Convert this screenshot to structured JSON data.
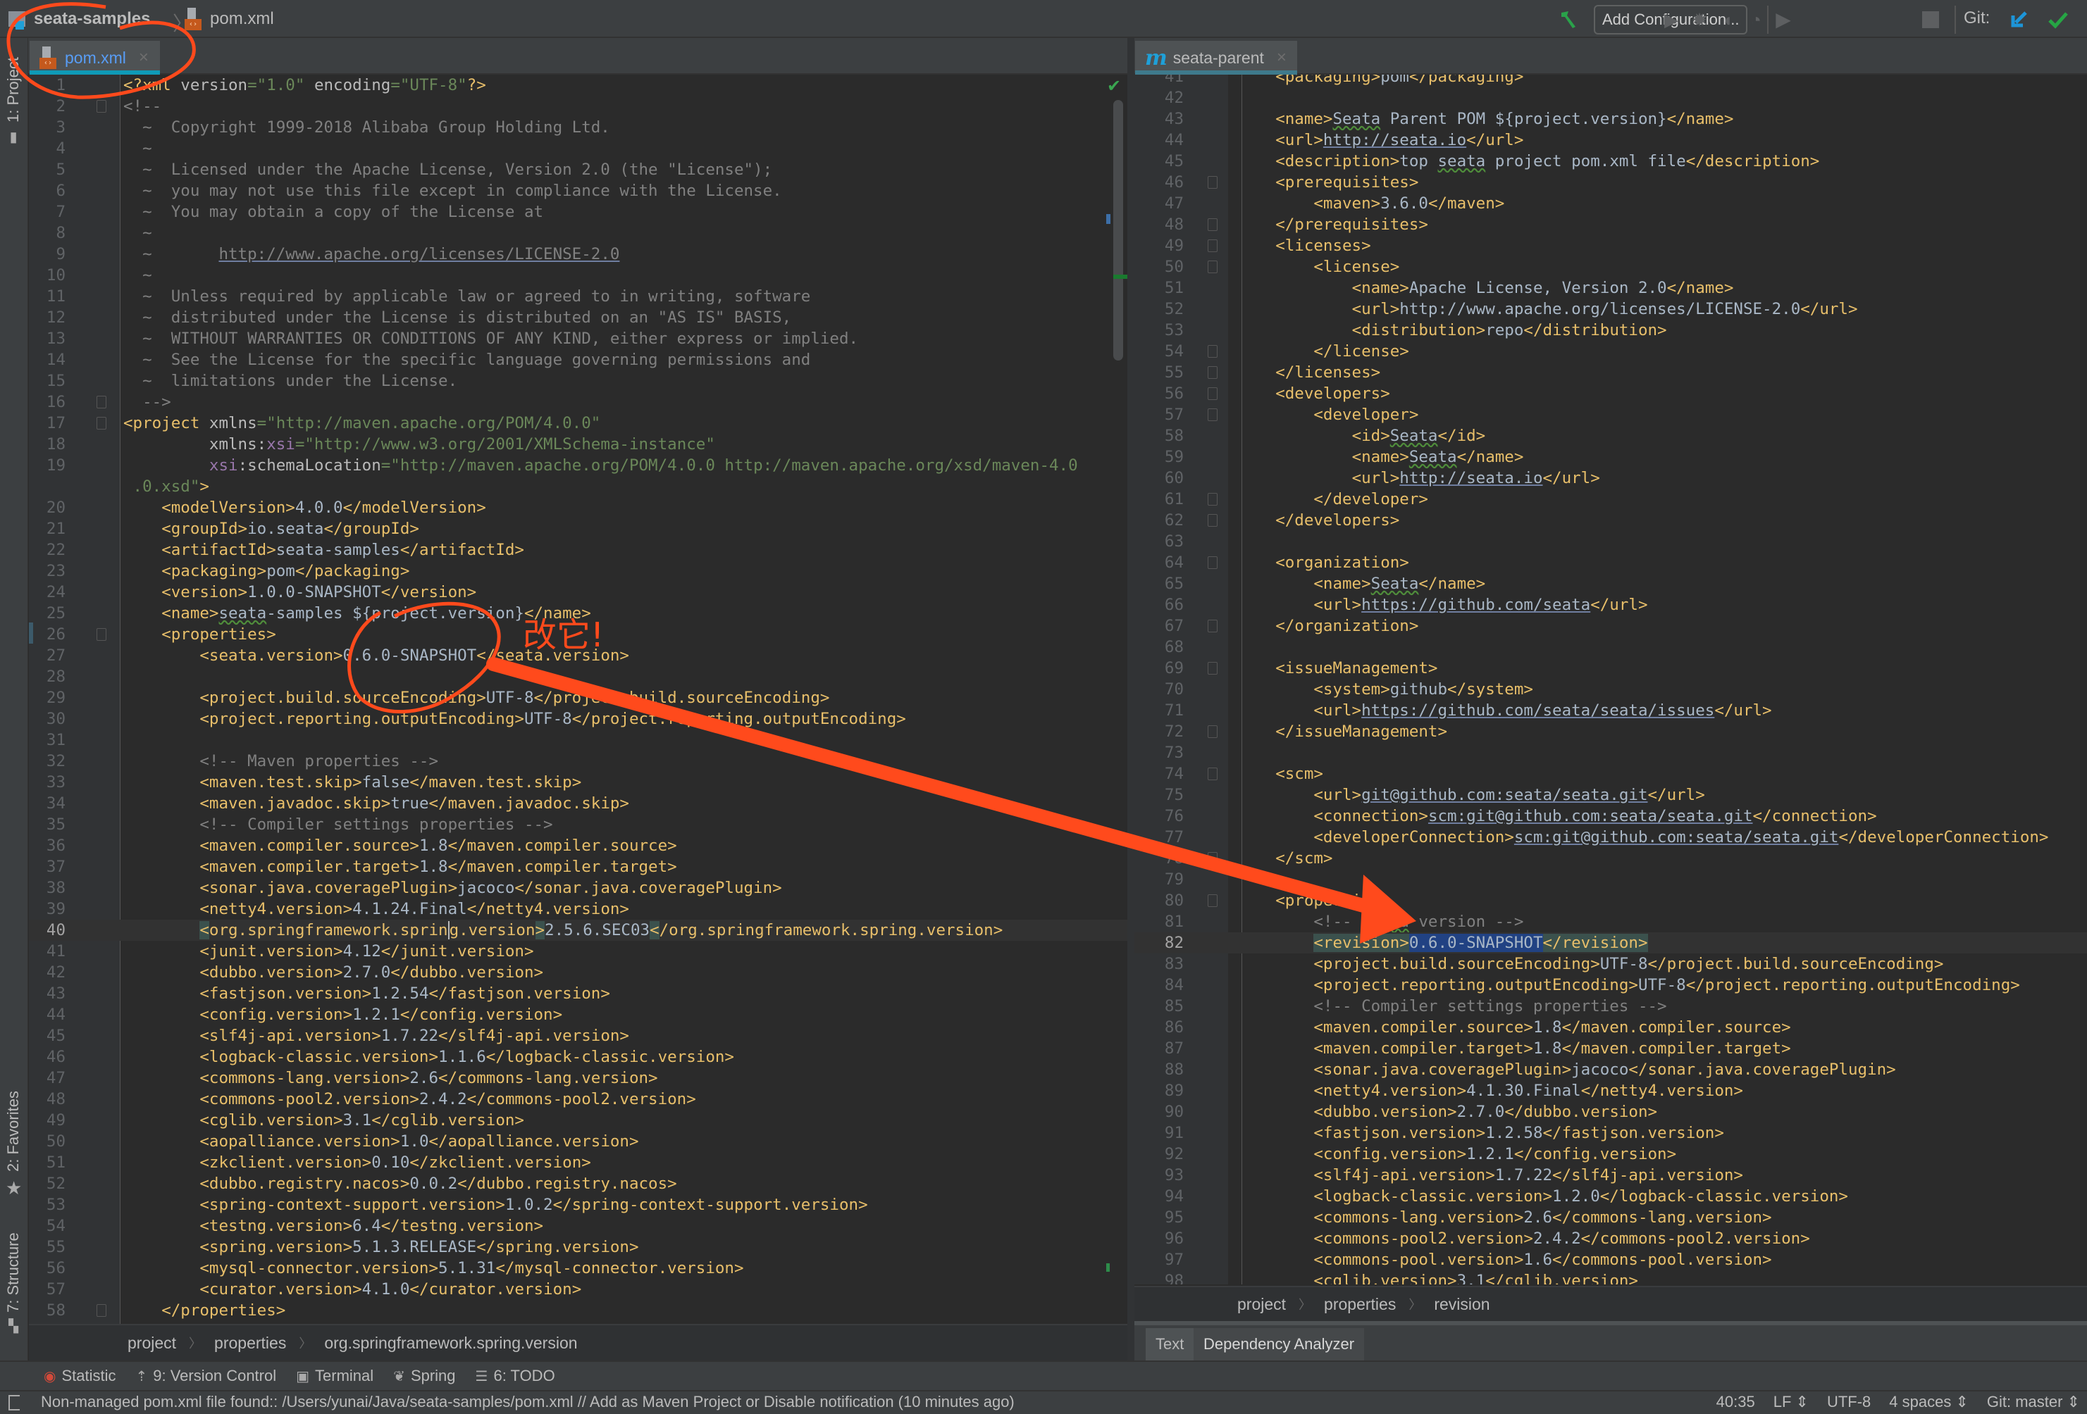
{
  "navbar": {
    "project": "seata-samples",
    "file": "pom.xml",
    "add_configuration": "Add Configuration...",
    "git_label": "Git:",
    "icons": [
      "build-hammer-icon",
      "run-icon",
      "debug-icon",
      "coverage-icon",
      "profile-icon",
      "stop-icon",
      "git-update-icon",
      "git-commit-icon"
    ]
  },
  "tabs": {
    "left": {
      "label": "pom.xml",
      "icon": "xml-file-icon"
    },
    "right": {
      "label": "seata-parent",
      "icon": "maven-icon"
    }
  },
  "left_strip": {
    "project": "1: Project",
    "favorites": "2: Favorites",
    "structure": "7: Structure"
  },
  "left_editor": {
    "current_line": 40,
    "lines": [
      {
        "n": "1",
        "h": "<span class='t'>&lt;?</span><span class='t'>xml</span> <span class='a'>version</span><span class='s'>=\"1.0\"</span> <span class='a'>encoding</span><span class='s'>=\"UTF-8\"</span><span class='t'>?&gt;</span>"
      },
      {
        "n": "2",
        "h": "<span class='c'>&lt;!--</span>",
        "fold": true
      },
      {
        "n": "3",
        "h": "<span class='c'>  ~  Copyright 1999-2018 Alibaba Group Holding Ltd.</span>"
      },
      {
        "n": "4",
        "h": "<span class='c'>  ~</span>"
      },
      {
        "n": "5",
        "h": "<span class='c'>  ~  Licensed under the Apache License, Version 2.0 (the \"License\");</span>"
      },
      {
        "n": "6",
        "h": "<span class='c'>  ~  you may not use this file except in compliance with the License.</span>"
      },
      {
        "n": "7",
        "h": "<span class='c'>  ~  You may obtain a copy of the License at</span>"
      },
      {
        "n": "8",
        "h": "<span class='c'>  ~</span>"
      },
      {
        "n": "9",
        "h": "<span class='c'>  ~       <span class='u' style='color:#808080'>http://www.apache.org/licenses/LICENSE-2.0</span></span>"
      },
      {
        "n": "10",
        "h": "<span class='c'>  ~</span>"
      },
      {
        "n": "11",
        "h": "<span class='c'>  ~  Unless required by applicable law or agreed to in writing, software</span>"
      },
      {
        "n": "12",
        "h": "<span class='c'>  ~  distributed under the License is distributed on an \"AS IS\" BASIS,</span>"
      },
      {
        "n": "13",
        "h": "<span class='c'>  ~  WITHOUT WARRANTIES OR CONDITIONS OF ANY KIND, either express or implied.</span>"
      },
      {
        "n": "14",
        "h": "<span class='c'>  ~  See the License for the specific language governing permissions and</span>"
      },
      {
        "n": "15",
        "h": "<span class='c'>  ~  limitations under the License.</span>"
      },
      {
        "n": "16",
        "h": "<span class='c'>  --&gt;</span>",
        "fold": true
      },
      {
        "n": "17",
        "h": "<span class='t'>&lt;project</span> <span class='a'>xmlns</span><span class='s'>=\"http://maven.apache.org/POM/4.0.0\"</span>",
        "fold": true
      },
      {
        "n": "18",
        "h": "         <span class='a'>xmlns:</span><span class='ns'>xsi</span><span class='s'>=\"http://www.w3.org/2001/XMLSchema-instance\"</span>"
      },
      {
        "n": "19",
        "h": "         <span class='ns'>xsi</span><span class='a'>:schemaLocation</span><span class='s'>=\"http://maven.apache.org/POM/4.0.0 http://maven.apache.org/xsd/maven-4.0</span>"
      },
      {
        "n": "",
        "h": " <span class='s'>.0.xsd\"</span><span class='t'>&gt;</span>"
      },
      {
        "n": "20",
        "h": "    <span class='t'>&lt;modelVersion&gt;</span>4.0.0<span class='t'>&lt;/modelVersion&gt;</span>"
      },
      {
        "n": "21",
        "h": "    <span class='t'>&lt;groupId&gt;</span>io.seata<span class='t'>&lt;/groupId&gt;</span>"
      },
      {
        "n": "22",
        "h": "    <span class='t'>&lt;artifactId&gt;</span>seata-samples<span class='t'>&lt;/artifactId&gt;</span>"
      },
      {
        "n": "23",
        "h": "    <span class='t'>&lt;packaging&gt;</span>pom<span class='t'>&lt;/packaging&gt;</span>"
      },
      {
        "n": "24",
        "h": "    <span class='t'>&lt;version&gt;</span>1.0.0-SNAPSHOT<span class='t'>&lt;/version&gt;</span>"
      },
      {
        "n": "25",
        "h": "    <span class='t'>&lt;name&gt;</span><span class='sq'>seata</span>-samples ${project.version}<span class='t'>&lt;/name&gt;</span>"
      },
      {
        "n": "26",
        "h": "    <span class='t'>&lt;properties&gt;</span>",
        "fold": true
      },
      {
        "n": "27",
        "h": "        <span class='t'>&lt;seata.version&gt;</span>0.6.0-SNAPSHOT<span class='t'>&lt;/seata.version&gt;</span>"
      },
      {
        "n": "28",
        "h": ""
      },
      {
        "n": "29",
        "h": "        <span class='t'>&lt;project.build.sourceEncoding&gt;</span>UTF-8<span class='t'>&lt;/project.build.sourceEncoding&gt;</span>"
      },
      {
        "n": "30",
        "h": "        <span class='t'>&lt;project.reporting.outputEncoding&gt;</span>UTF-8<span class='t'>&lt;/project.reporting.outputEncoding&gt;</span>"
      },
      {
        "n": "31",
        "h": ""
      },
      {
        "n": "32",
        "h": "        <span class='c'>&lt;!-- Maven properties --&gt;</span>"
      },
      {
        "n": "33",
        "h": "        <span class='t'>&lt;maven.test.skip&gt;</span>false<span class='t'>&lt;/maven.test.skip&gt;</span>"
      },
      {
        "n": "34",
        "h": "        <span class='t'>&lt;maven.javadoc.skip&gt;</span>true<span class='t'>&lt;/maven.javadoc.skip&gt;</span>"
      },
      {
        "n": "35",
        "h": "        <span class='c'>&lt;!-- Compiler settings properties --&gt;</span>"
      },
      {
        "n": "36",
        "h": "        <span class='t'>&lt;maven.compiler.source&gt;</span>1.8<span class='t'>&lt;/maven.compiler.source&gt;</span>"
      },
      {
        "n": "37",
        "h": "        <span class='t'>&lt;maven.compiler.target&gt;</span>1.8<span class='t'>&lt;/maven.compiler.target&gt;</span>"
      },
      {
        "n": "38",
        "h": "        <span class='t'>&lt;sonar.java.coveragePlugin&gt;</span>jacoco<span class='t'>&lt;/sonar.java.coveragePlugin&gt;</span>"
      },
      {
        "n": "39",
        "h": "        <span class='t'>&lt;netty4.version&gt;</span>4.1.24.Final<span class='t'>&lt;/netty4.version&gt;</span>"
      },
      {
        "n": "40",
        "h": "        <span class='t match'>&lt;</span><span class='t'>org.springframework.sprin<span class='caret'></span>g.version</span><span class='t match'>&gt;</span>2.5.6.SEC03<span class='t match'>&lt;</span><span class='t'>/org.springframework.spring.version&gt;</span>"
      },
      {
        "n": "41",
        "h": "        <span class='t'>&lt;junit.version&gt;</span>4.12<span class='t'>&lt;/junit.version&gt;</span>"
      },
      {
        "n": "42",
        "h": "        <span class='t'>&lt;dubbo.version&gt;</span>2.7.0<span class='t'>&lt;/dubbo.version&gt;</span>"
      },
      {
        "n": "43",
        "h": "        <span class='t'>&lt;fastjson.version&gt;</span>1.2.54<span class='t'>&lt;/fastjson.version&gt;</span>"
      },
      {
        "n": "44",
        "h": "        <span class='t'>&lt;config.version&gt;</span>1.2.1<span class='t'>&lt;/config.version&gt;</span>"
      },
      {
        "n": "45",
        "h": "        <span class='t'>&lt;slf4j-api.version&gt;</span>1.7.22<span class='t'>&lt;/slf4j-api.version&gt;</span>"
      },
      {
        "n": "46",
        "h": "        <span class='t'>&lt;logback-classic.version&gt;</span>1.1.6<span class='t'>&lt;/logback-classic.version&gt;</span>"
      },
      {
        "n": "47",
        "h": "        <span class='t'>&lt;commons-lang.version&gt;</span>2.6<span class='t'>&lt;/commons-lang.version&gt;</span>"
      },
      {
        "n": "48",
        "h": "        <span class='t'>&lt;commons-pool2.version&gt;</span>2.4.2<span class='t'>&lt;/commons-pool2.version&gt;</span>"
      },
      {
        "n": "49",
        "h": "        <span class='t'>&lt;cglib.version&gt;</span>3.1<span class='t'>&lt;/cglib.version&gt;</span>"
      },
      {
        "n": "50",
        "h": "        <span class='t'>&lt;aopalliance.version&gt;</span>1.0<span class='t'>&lt;/aopalliance.version&gt;</span>"
      },
      {
        "n": "51",
        "h": "        <span class='t'>&lt;zkclient.version&gt;</span>0.10<span class='t'>&lt;/zkclient.version&gt;</span>"
      },
      {
        "n": "52",
        "h": "        <span class='t'>&lt;dubbo.registry.nacos&gt;</span>0.0.2<span class='t'>&lt;/dubbo.registry.nacos&gt;</span>"
      },
      {
        "n": "53",
        "h": "        <span class='t'>&lt;spring-context-support.version&gt;</span>1.0.2<span class='t'>&lt;/spring-context-support.version&gt;</span>"
      },
      {
        "n": "54",
        "h": "        <span class='t'>&lt;testng.version&gt;</span>6.4<span class='t'>&lt;/testng.version&gt;</span>"
      },
      {
        "n": "55",
        "h": "        <span class='t'>&lt;spring.version&gt;</span>5.1.3.RELEASE<span class='t'>&lt;/spring.version&gt;</span>"
      },
      {
        "n": "56",
        "h": "        <span class='t'>&lt;mysql-connector.version&gt;</span>5.1.31<span class='t'>&lt;/mysql-connector.version&gt;</span>"
      },
      {
        "n": "57",
        "h": "        <span class='t'>&lt;curator.version&gt;</span>4.1.0<span class='t'>&lt;/curator.version&gt;</span>"
      },
      {
        "n": "58",
        "h": "    <span class='t'>&lt;/properties&gt;</span>",
        "fold": true
      }
    ]
  },
  "right_editor": {
    "current_line": 82,
    "lines": [
      {
        "n": "41",
        "h": "    <span class='t'>&lt;packaging&gt;</span>pom<span class='t'>&lt;/packaging&gt;</span>"
      },
      {
        "n": "42",
        "h": ""
      },
      {
        "n": "43",
        "h": "    <span class='t'>&lt;name&gt;</span><span class='sq'>Seata</span> Parent POM ${project.version}<span class='t'>&lt;/name&gt;</span>"
      },
      {
        "n": "44",
        "h": "    <span class='t'>&lt;url&gt;</span><span class='u'>http://seata.io</span><span class='t'>&lt;/url&gt;</span>"
      },
      {
        "n": "45",
        "h": "    <span class='t'>&lt;description&gt;</span>top <span class='sq'>seata</span> project pom.xml file<span class='t'>&lt;/description&gt;</span>"
      },
      {
        "n": "46",
        "h": "    <span class='t'>&lt;prerequisites&gt;</span>",
        "fold": true
      },
      {
        "n": "47",
        "h": "        <span class='t'>&lt;maven&gt;</span>3.6.0<span class='t'>&lt;/maven&gt;</span>"
      },
      {
        "n": "48",
        "h": "    <span class='t'>&lt;/prerequisites&gt;</span>",
        "fold": true
      },
      {
        "n": "49",
        "h": "    <span class='t'>&lt;licenses&gt;</span>",
        "fold": true
      },
      {
        "n": "50",
        "h": "        <span class='t'>&lt;license&gt;</span>",
        "fold": true
      },
      {
        "n": "51",
        "h": "            <span class='t'>&lt;name&gt;</span>Apache License, Version 2.0<span class='t'>&lt;/name&gt;</span>"
      },
      {
        "n": "52",
        "h": "            <span class='t'>&lt;url&gt;</span>http://www.apache.org/licenses/LICENSE-2.0<span class='t'>&lt;/url&gt;</span>"
      },
      {
        "n": "53",
        "h": "            <span class='t'>&lt;distribution&gt;</span>repo<span class='t'>&lt;/distribution&gt;</span>"
      },
      {
        "n": "54",
        "h": "        <span class='t'>&lt;/license&gt;</span>",
        "fold": true
      },
      {
        "n": "55",
        "h": "    <span class='t'>&lt;/licenses&gt;</span>",
        "fold": true
      },
      {
        "n": "56",
        "h": "    <span class='t'>&lt;developers&gt;</span>",
        "fold": true
      },
      {
        "n": "57",
        "h": "        <span class='t'>&lt;developer&gt;</span>",
        "fold": true
      },
      {
        "n": "58",
        "h": "            <span class='t'>&lt;id&gt;</span><span class='sq'>Seata</span><span class='t'>&lt;/id&gt;</span>"
      },
      {
        "n": "59",
        "h": "            <span class='t'>&lt;name&gt;</span><span class='sq'>Seata</span><span class='t'>&lt;/name&gt;</span>"
      },
      {
        "n": "60",
        "h": "            <span class='t'>&lt;url&gt;</span><span class='u'>http://seata.io</span><span class='t'>&lt;/url&gt;</span>"
      },
      {
        "n": "61",
        "h": "        <span class='t'>&lt;/developer&gt;</span>",
        "fold": true
      },
      {
        "n": "62",
        "h": "    <span class='t'>&lt;/developers&gt;</span>",
        "fold": true
      },
      {
        "n": "63",
        "h": ""
      },
      {
        "n": "64",
        "h": "    <span class='t'>&lt;organization&gt;</span>",
        "fold": true
      },
      {
        "n": "65",
        "h": "        <span class='t'>&lt;name&gt;</span><span class='sq'>Seata</span><span class='t'>&lt;/name&gt;</span>"
      },
      {
        "n": "66",
        "h": "        <span class='t'>&lt;url&gt;</span><span class='u'>https://github.com/seata</span><span class='t'>&lt;/url&gt;</span>"
      },
      {
        "n": "67",
        "h": "    <span class='t'>&lt;/organization&gt;</span>",
        "fold": true
      },
      {
        "n": "68",
        "h": ""
      },
      {
        "n": "69",
        "h": "    <span class='t'>&lt;issueManagement&gt;</span>",
        "fold": true
      },
      {
        "n": "70",
        "h": "        <span class='t'>&lt;system&gt;</span>github<span class='t'>&lt;/system&gt;</span>"
      },
      {
        "n": "71",
        "h": "        <span class='t'>&lt;url&gt;</span><span class='u'>https://github.com/seata/seata/issues</span><span class='t'>&lt;/url&gt;</span>"
      },
      {
        "n": "72",
        "h": "    <span class='t'>&lt;/issueManagement&gt;</span>",
        "fold": true
      },
      {
        "n": "73",
        "h": ""
      },
      {
        "n": "74",
        "h": "    <span class='t'>&lt;scm&gt;</span>",
        "fold": true
      },
      {
        "n": "75",
        "h": "        <span class='t'>&lt;url&gt;</span><span class='u'>git@github.com:seata/seata.git</span><span class='t'>&lt;/url&gt;</span>"
      },
      {
        "n": "76",
        "h": "        <span class='t'>&lt;connection&gt;</span><span class='u'>scm:git@github.com:seata/seata.git</span><span class='t'>&lt;/connection&gt;</span>"
      },
      {
        "n": "77",
        "h": "        <span class='t'>&lt;developerConnection&gt;</span><span class='u'>scm:git@github.com:seata/seata.git</span><span class='t'>&lt;/developerConnection&gt;</span>"
      },
      {
        "n": "78",
        "h": "    <span class='t'>&lt;/scm&gt;</span>",
        "fold": true
      },
      {
        "n": "79",
        "h": ""
      },
      {
        "n": "80",
        "h": "    <span class='t'>&lt;properties&gt;</span>",
        "fold": true
      },
      {
        "n": "81",
        "h": "        <span class='c'>&lt;!-- <span class='sq'>seata</span> version --&gt;</span>"
      },
      {
        "n": "82",
        "h": "        <span class='t match'>&lt;revision&gt;</span><span class='sel'>0.6.0-SNAPSHOT</span><span class='t match'>&lt;/revision&gt;</span>"
      },
      {
        "n": "83",
        "h": "        <span class='t'>&lt;project.build.sourceEncoding&gt;</span>UTF-8<span class='t'>&lt;/project.build.sourceEncoding&gt;</span>"
      },
      {
        "n": "84",
        "h": "        <span class='t'>&lt;project.reporting.outputEncoding&gt;</span>UTF-8<span class='t'>&lt;/project.reporting.outputEncoding&gt;</span>"
      },
      {
        "n": "85",
        "h": "        <span class='c'>&lt;!-- Compiler settings properties --&gt;</span>"
      },
      {
        "n": "86",
        "h": "        <span class='t'>&lt;maven.compiler.source&gt;</span>1.8<span class='t'>&lt;/maven.compiler.source&gt;</span>"
      },
      {
        "n": "87",
        "h": "        <span class='t'>&lt;maven.compiler.target&gt;</span>1.8<span class='t'>&lt;/maven.compiler.target&gt;</span>"
      },
      {
        "n": "88",
        "h": "        <span class='t'>&lt;sonar.java.coveragePlugin&gt;</span>jacoco<span class='t'>&lt;/sonar.java.coveragePlugin&gt;</span>"
      },
      {
        "n": "89",
        "h": "        <span class='t'>&lt;netty4.version&gt;</span>4.1.30.Final<span class='t'>&lt;/netty4.version&gt;</span>"
      },
      {
        "n": "90",
        "h": "        <span class='t'>&lt;dubbo.version&gt;</span>2.7.0<span class='t'>&lt;/dubbo.version&gt;</span>"
      },
      {
        "n": "91",
        "h": "        <span class='t'>&lt;fastjson.version&gt;</span>1.2.58<span class='t'>&lt;/fastjson.version&gt;</span>"
      },
      {
        "n": "92",
        "h": "        <span class='t'>&lt;config.version&gt;</span>1.2.1<span class='t'>&lt;/config.version&gt;</span>"
      },
      {
        "n": "93",
        "h": "        <span class='t'>&lt;slf4j-api.version&gt;</span>1.7.22<span class='t'>&lt;/slf4j-api.version&gt;</span>"
      },
      {
        "n": "94",
        "h": "        <span class='t'>&lt;logback-classic.version&gt;</span>1.2.0<span class='t'>&lt;/logback-classic.version&gt;</span>"
      },
      {
        "n": "95",
        "h": "        <span class='t'>&lt;commons-lang.version&gt;</span>2.6<span class='t'>&lt;/commons-lang.version&gt;</span>"
      },
      {
        "n": "96",
        "h": "        <span class='t'>&lt;commons-pool2.version&gt;</span>2.4.2<span class='t'>&lt;/commons-pool2.version&gt;</span>"
      },
      {
        "n": "97",
        "h": "        <span class='t'>&lt;commons-pool.version&gt;</span>1.6<span class='t'>&lt;/commons-pool.version&gt;</span>"
      },
      {
        "n": "98",
        "h": "        <span class='t'>&lt;cglib.version&gt;</span>3.1<span class='t'>&lt;/cglib.version&gt;</span>"
      }
    ]
  },
  "breadcrumbs": {
    "left": [
      "project",
      "properties",
      "org.springframework.spring.version"
    ],
    "right": [
      "project",
      "properties",
      "revision"
    ]
  },
  "sub_tabs": [
    "Text",
    "Dependency Analyzer"
  ],
  "tool_windows": [
    {
      "label": "Statistic",
      "icon": "statistic-icon"
    },
    {
      "label": "9: Version Control",
      "icon": "version-control-icon"
    },
    {
      "label": "Terminal",
      "icon": "terminal-icon"
    },
    {
      "label": "Spring",
      "icon": "spring-leaf-icon"
    },
    {
      "label": "6: TODO",
      "icon": "todo-list-icon"
    }
  ],
  "status": {
    "message": "Non-managed pom.xml file found:: /Users/yunai/Java/seata-samples/pom.xml // Add as Maven Project or Disable notification (10 minutes ago)",
    "position": "40:35",
    "line_separator": "LF",
    "encoding": "UTF-8",
    "indent": "4 spaces",
    "git_branch": "Git: master"
  },
  "annotation": {
    "text": "改它!",
    "color": "#ff4a1c"
  }
}
